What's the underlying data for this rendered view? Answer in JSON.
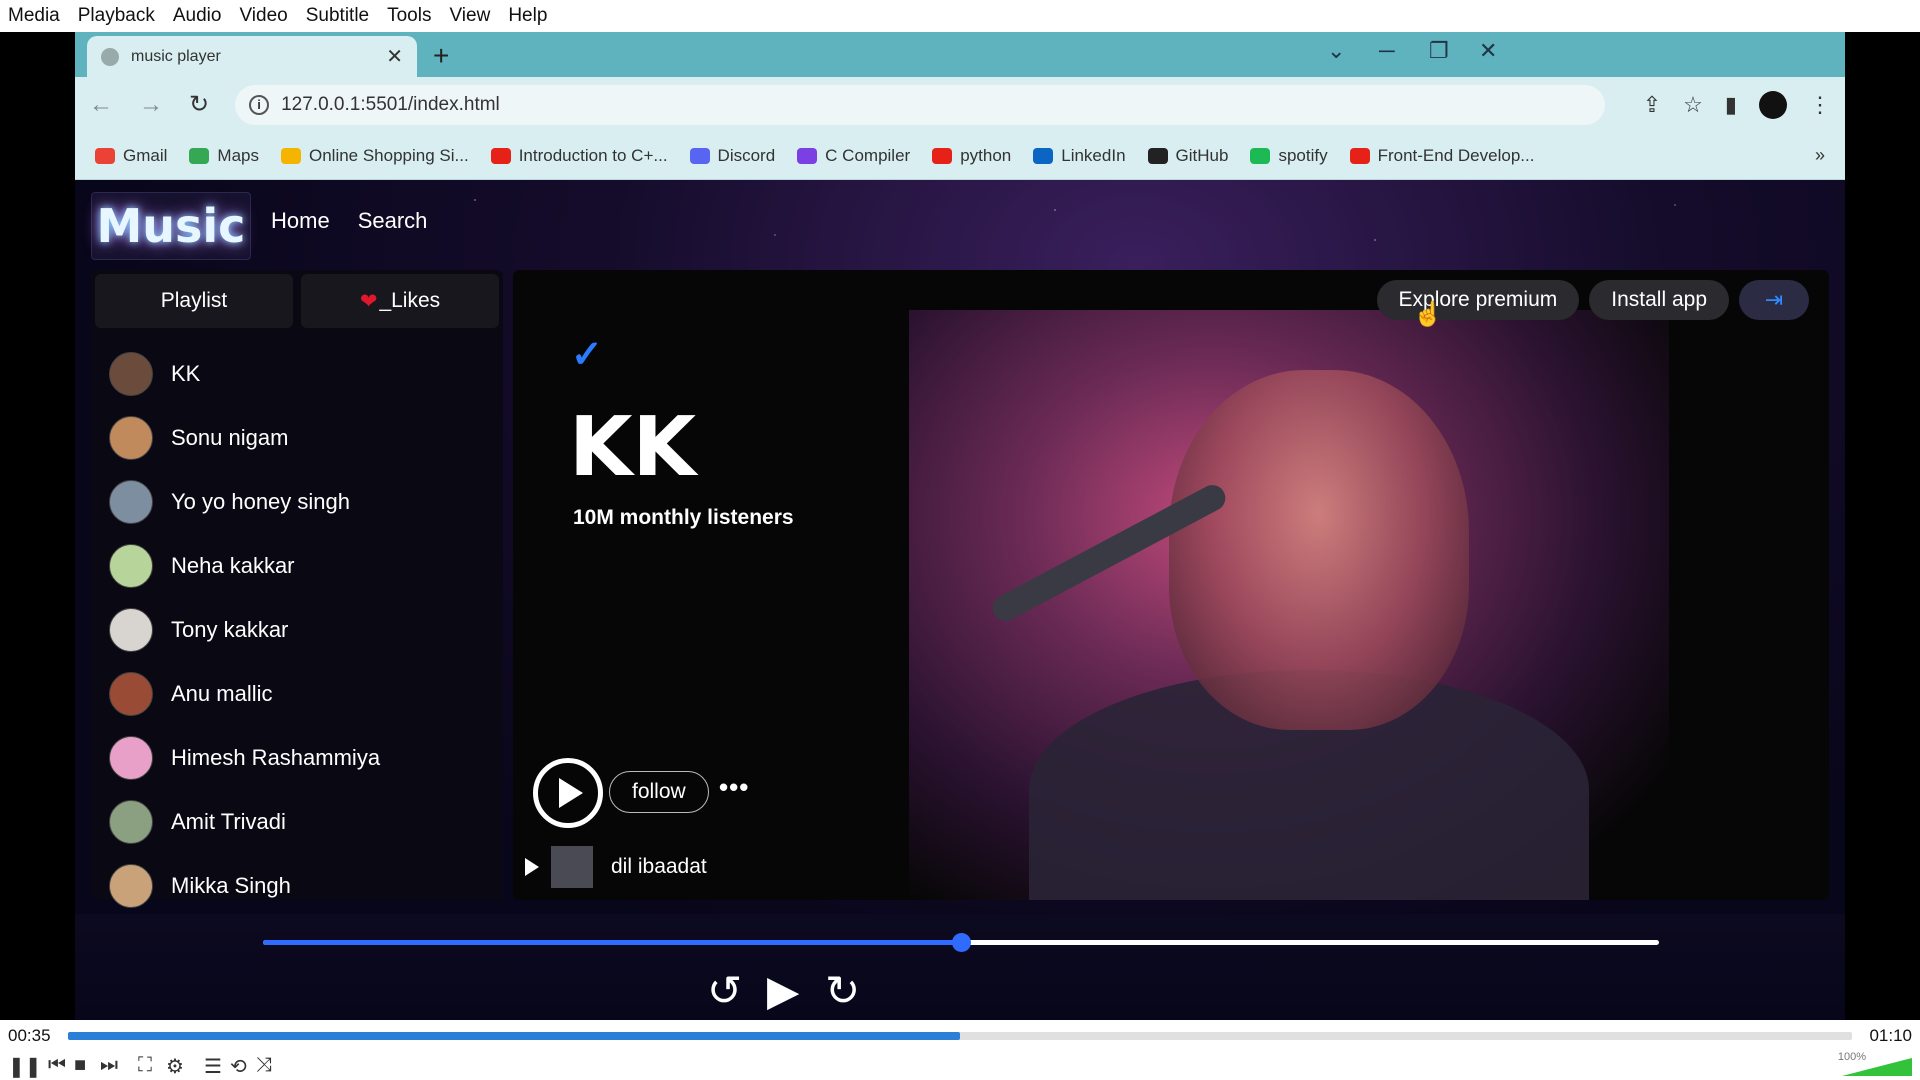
{
  "vlc_menu": [
    "Media",
    "Playback",
    "Audio",
    "Video",
    "Subtitle",
    "Tools",
    "View",
    "Help"
  ],
  "browser": {
    "tab_title": "music player",
    "url": "127.0.0.1:5501/index.html",
    "bookmarks": [
      {
        "label": "Gmail",
        "color": "#ea4335"
      },
      {
        "label": "Maps",
        "color": "#34a853"
      },
      {
        "label": "Online Shopping Si...",
        "color": "#f4b400"
      },
      {
        "label": "Introduction to C+...",
        "color": "#e62117"
      },
      {
        "label": "Discord",
        "color": "#5865f2"
      },
      {
        "label": "C Compiler",
        "color": "#7b3fe4"
      },
      {
        "label": "python",
        "color": "#e62117"
      },
      {
        "label": "LinkedIn",
        "color": "#0a66c2"
      },
      {
        "label": "GitHub",
        "color": "#222222"
      },
      {
        "label": "spotify",
        "color": "#1db954"
      },
      {
        "label": "Front-End Develop...",
        "color": "#e62117"
      }
    ]
  },
  "app": {
    "logo": "Music",
    "nav": {
      "home": "Home",
      "search": "Search"
    },
    "sidebar_tabs": {
      "playlist": "Playlist",
      "likes": "_Likes"
    },
    "artists": [
      {
        "name": "KK",
        "avatar_color": "#6b4b3b"
      },
      {
        "name": "Sonu nigam",
        "avatar_color": "#c08a5c"
      },
      {
        "name": "Yo yo honey singh",
        "avatar_color": "#7d8ea0"
      },
      {
        "name": "Neha kakkar",
        "avatar_color": "#b7d59a"
      },
      {
        "name": "Tony kakkar",
        "avatar_color": "#d8d4cf"
      },
      {
        "name": "Anu mallic",
        "avatar_color": "#9a4b35"
      },
      {
        "name": "Himesh Rashammiya",
        "avatar_color": "#e8a0c8"
      },
      {
        "name": "Amit Trivadi",
        "avatar_color": "#8aa080"
      },
      {
        "name": "Mikka Singh",
        "avatar_color": "#c9a27a"
      }
    ],
    "top_actions": {
      "premium": "Explore premium",
      "install": "Install app"
    },
    "artist_title": "KK",
    "listeners": "10M monthly listeners",
    "follow": "follow",
    "more": "•••",
    "song": "dil ibaadat",
    "progress_fraction": 0.5,
    "accent": "#2f6bff"
  },
  "vlc": {
    "time_elapsed": "00:35",
    "time_total": "01:10",
    "progress_fraction": 0.5,
    "volume": "100%"
  }
}
